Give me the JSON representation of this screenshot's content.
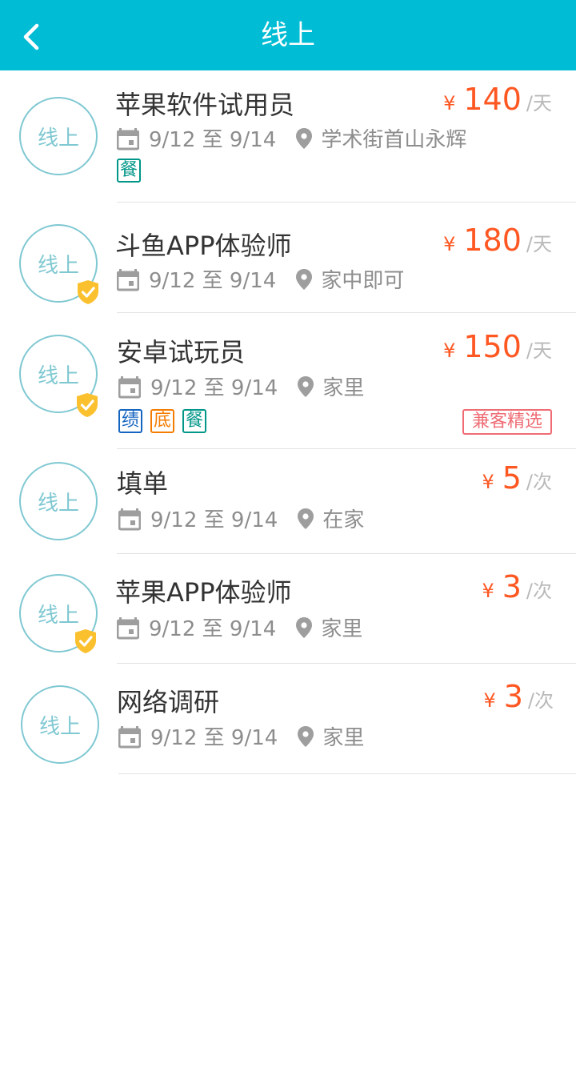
{
  "header": {
    "title": "线上",
    "back_icon": "chevron-left-icon",
    "background": "#00bcd4"
  },
  "jobs": [
    {
      "avatar_label": "线上",
      "title": "苹果软件试用员",
      "currency": "¥",
      "price": "140",
      "unit": "/天",
      "date_range": "9/12 至 9/14",
      "location": "学术街首山永辉",
      "verified": false,
      "tags": [
        "餐"
      ]
    },
    {
      "avatar_label": "线上",
      "title": "斗鱼APP体验师",
      "currency": "¥",
      "price": "180",
      "unit": "/天",
      "date_range": "9/12 至 9/14",
      "location": "家中即可",
      "verified": true,
      "tags": []
    },
    {
      "avatar_label": "线上",
      "title": "安卓试玩员",
      "currency": "¥",
      "price": "150",
      "unit": "/天",
      "date_range": "9/12 至 9/14",
      "location": "家里",
      "verified": true,
      "tags": [
        "绩",
        "底",
        "餐"
      ],
      "featured_badge": "兼客精选"
    },
    {
      "avatar_label": "线上",
      "title": "填单",
      "currency": "¥",
      "price": "5",
      "unit": "/次",
      "date_range": "9/12 至 9/14",
      "location": "在家",
      "verified": false,
      "tags": []
    },
    {
      "avatar_label": "线上",
      "title": "苹果APP体验师",
      "currency": "¥",
      "price": "3",
      "unit": "/次",
      "date_range": "9/12 至 9/14",
      "location": "家里",
      "verified": true,
      "tags": []
    },
    {
      "avatar_label": "线上",
      "title": "网络调研",
      "currency": "¥",
      "price": "3",
      "unit": "/次",
      "date_range": "9/12 至 9/14",
      "location": "家里",
      "verified": false,
      "tags": []
    }
  ],
  "colors": {
    "accent": "#00bcd4",
    "price": "#ff5722",
    "avatar_border": "#7fc8d2",
    "tag_green": "#009688",
    "tag_blue": "#1565c0",
    "tag_orange": "#f57c00",
    "featured": "#ef6c74",
    "verified_badge": "#fbc02d"
  },
  "icons": {
    "date": "calendar-icon",
    "location": "location-pin-icon",
    "verified": "verified-shield-icon"
  }
}
